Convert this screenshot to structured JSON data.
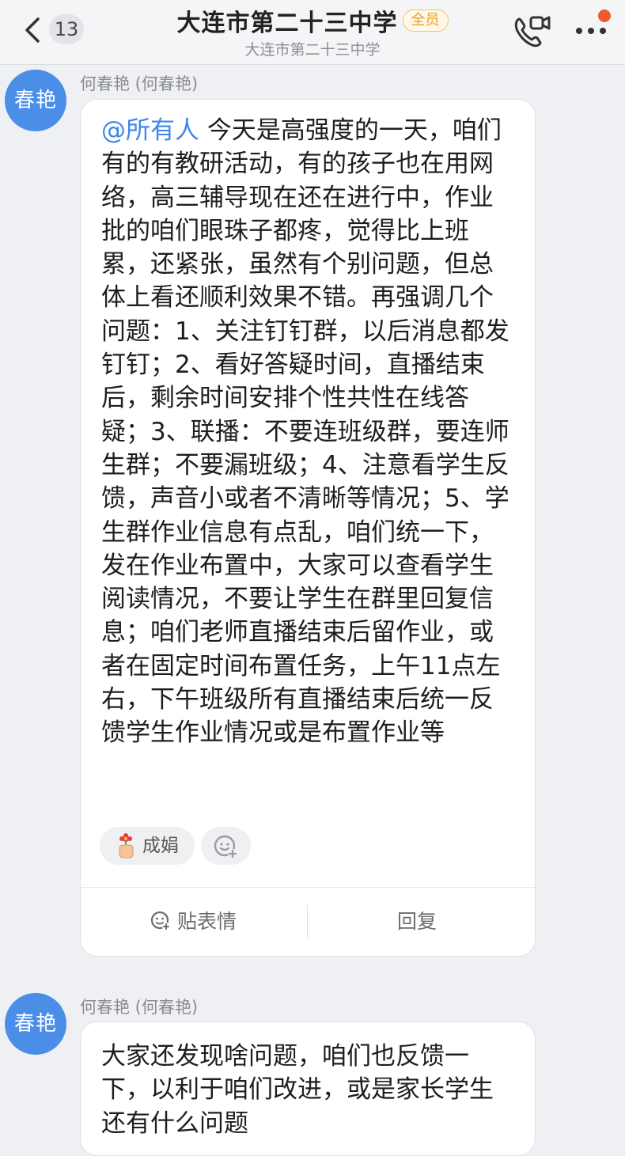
{
  "header": {
    "back_count": "13",
    "title": "大连市第二十三中学",
    "member_badge": "全员",
    "subtitle": "大连市第二十三中学"
  },
  "messages": [
    {
      "avatar_text": "春艳",
      "sender": "何春艳 (何春艳)",
      "mention": "@所有人",
      "text": " 今天是高强度的一天，咱们有的有教研活动，有的孩子也在用网络，高三辅导现在还在进行中，作业批的咱们眼珠子都疼，觉得比上班累，还紧张，虽然有个别问题，但总体上看还顺利效果不错。再强调几个问题：1、关注钉钉群，以后消息都发钉钉；2、看好答疑时间，直播结束后，剩余时间安排个性共性在线答疑；3、联播：不要连班级群，要连师生群；不要漏班级；4、注意看学生反馈，声音小或者不清晰等情况；5、学生群作业信息有点乱，咱们统一下，发在作业布置中，大家可以查看学生阅读情况，不要让学生在群里回复信息；咱们老师直播结束后留作业，或者在固定时间布置任务，上午11点左右，下午班级所有直播结束后统一反馈学生作业情况或是布置作业等",
      "reaction_user": "成娟",
      "action_sticker": "贴表情",
      "action_reply": "回复"
    },
    {
      "avatar_text": "春艳",
      "sender": "何春艳 (何春艳)",
      "text": "大家还发现啥问题，咱们也反馈一下，以利于咱们改进，或是家长学生还有什么问题"
    }
  ],
  "colors": {
    "accent": "#3f87e8",
    "avatar": "#4a8ee8",
    "badge": "#e7a02a",
    "notify_dot": "#f25a2d"
  },
  "icons": [
    "back-arrow-icon",
    "video-call-icon",
    "more-icon",
    "hand-flower-emoji-icon",
    "add-reaction-icon",
    "sticker-icon"
  ]
}
